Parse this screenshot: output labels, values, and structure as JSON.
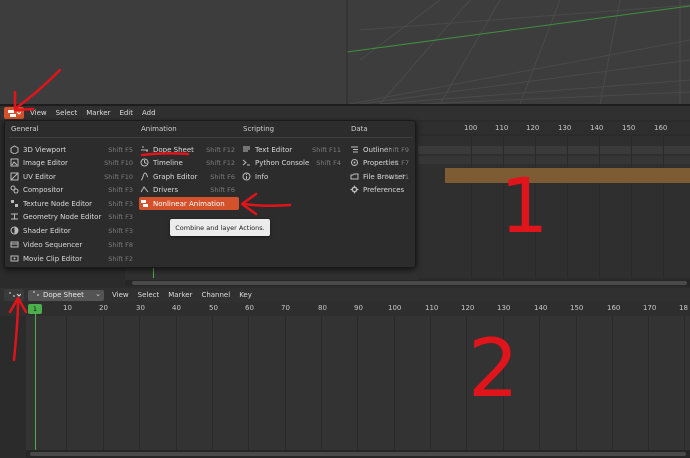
{
  "top_editor": {
    "menu_bar": [
      "View",
      "Select",
      "Marker",
      "Edit",
      "Add"
    ],
    "ruler_ticks": [
      "100",
      "110",
      "120",
      "130",
      "140",
      "150",
      "160"
    ]
  },
  "editor_menu": {
    "columns": [
      {
        "header": "General",
        "items": [
          {
            "label": "3D Viewport",
            "shortcut": "Shift F5",
            "icon": "viewport-3d-icon"
          },
          {
            "label": "Image Editor",
            "shortcut": "Shift F10",
            "icon": "image-editor-icon"
          },
          {
            "label": "UV Editor",
            "shortcut": "Shift F10",
            "icon": "uv-editor-icon"
          },
          {
            "label": "Compositor",
            "shortcut": "Shift F3",
            "icon": "compositor-icon"
          },
          {
            "label": "Texture Node Editor",
            "shortcut": "Shift F3",
            "icon": "texture-node-icon"
          },
          {
            "label": "Geometry Node Editor",
            "shortcut": "Shift F3",
            "icon": "geometry-node-icon"
          },
          {
            "label": "Shader Editor",
            "shortcut": "Shift F3",
            "icon": "shader-editor-icon"
          },
          {
            "label": "Video Sequencer",
            "shortcut": "Shift F8",
            "icon": "video-sequencer-icon"
          },
          {
            "label": "Movie Clip Editor",
            "shortcut": "Shift F2",
            "icon": "movie-clip-icon"
          }
        ]
      },
      {
        "header": "Animation",
        "items": [
          {
            "label": "Dope Sheet",
            "shortcut": "Shift F12",
            "icon": "dope-sheet-icon"
          },
          {
            "label": "Timeline",
            "shortcut": "Shift F12",
            "icon": "timeline-icon"
          },
          {
            "label": "Graph Editor",
            "shortcut": "Shift F6",
            "icon": "graph-editor-icon"
          },
          {
            "label": "Drivers",
            "shortcut": "Shift F6",
            "icon": "drivers-icon"
          },
          {
            "label": "Nonlinear Animation",
            "shortcut": "",
            "icon": "nla-icon",
            "active": true
          }
        ]
      },
      {
        "header": "Scripting",
        "items": [
          {
            "label": "Text Editor",
            "shortcut": "Shift F11",
            "icon": "text-editor-icon"
          },
          {
            "label": "Python Console",
            "shortcut": "Shift F4",
            "icon": "python-console-icon"
          },
          {
            "label": "Info",
            "shortcut": "",
            "icon": "info-icon"
          }
        ]
      },
      {
        "header": "Data",
        "items": [
          {
            "label": "Outliner",
            "shortcut": "Shift F9",
            "icon": "outliner-icon"
          },
          {
            "label": "Properties",
            "shortcut": "Shift F7",
            "icon": "properties-icon"
          },
          {
            "label": "File Browser",
            "shortcut": "Shift F1",
            "icon": "file-browser-icon"
          },
          {
            "label": "Preferences",
            "shortcut": "",
            "icon": "preferences-icon"
          }
        ]
      }
    ],
    "tooltip": "Combine and layer Actions."
  },
  "bottom_editor": {
    "mode_select": "Dope Sheet",
    "menu_bar": [
      "View",
      "Select",
      "Marker",
      "Channel",
      "Key"
    ],
    "current_frame": "1",
    "ruler_ticks": [
      "10",
      "20",
      "30",
      "40",
      "50",
      "60",
      "70",
      "80",
      "90",
      "100",
      "110",
      "120",
      "130",
      "140",
      "150",
      "160",
      "170",
      "18"
    ]
  },
  "annotations": {
    "label_1": "1",
    "label_2": "2"
  },
  "colors": {
    "accent_active": "#d4522b",
    "frame_green": "#4bb04b",
    "annotation_red": "#e0141b"
  }
}
